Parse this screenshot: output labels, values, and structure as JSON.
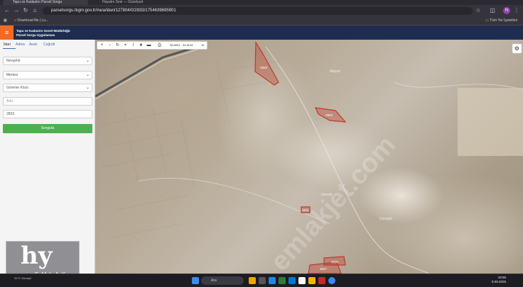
{
  "browser": {
    "tabs": [
      {
        "label": "Tapu ve Kadastro Parsel Sorgu"
      },
      {
        "label": "Hayatın Sesi — Güzelyurt"
      }
    ],
    "url": "parselsorgu.tkgm.gov.tr/#ara/idari/127804/0/2833/1754639695901",
    "bookmarks": {
      "left": "Download file | Lu...",
      "right": "Tüm Yer İşaretleri"
    }
  },
  "app": {
    "title_line1": "Tapu ve Kadastro Genel Müdürlüğü",
    "title_line2": "Parsel Sorgu Uygulaması"
  },
  "sidebar": {
    "tabs": [
      "İdari",
      "Adres",
      "Ara/z",
      "Coğrafi"
    ],
    "province": "Nevşehir",
    "district": "Merkez",
    "neighborhood": "Göreme Köyü",
    "block_placeholder": "Ada",
    "parcel_value": "2833",
    "query_button": "Sorgula"
  },
  "map": {
    "coords": "38.6651 · 34.8134",
    "scale": "16",
    "place_labels": [
      "Maçan",
      "Gevelir",
      "Çavuşin"
    ],
    "parcels": [
      "2833",
      "2834",
      "2835",
      "2836",
      "2837"
    ],
    "watermark": "emlakjet.com"
  },
  "logo": {
    "main": "hy",
    "sub": "EMLAK"
  },
  "taskbar": {
    "search_placeholder": "Ara",
    "time": "19:56",
    "date": "8.08.2025",
    "weather": "31°C Güneşli"
  },
  "colors": {
    "header_bg": "#1e2d4f",
    "menu_accent": "#f26b21",
    "query_green": "#4caf50",
    "parcel_fill": "#c0392b"
  }
}
